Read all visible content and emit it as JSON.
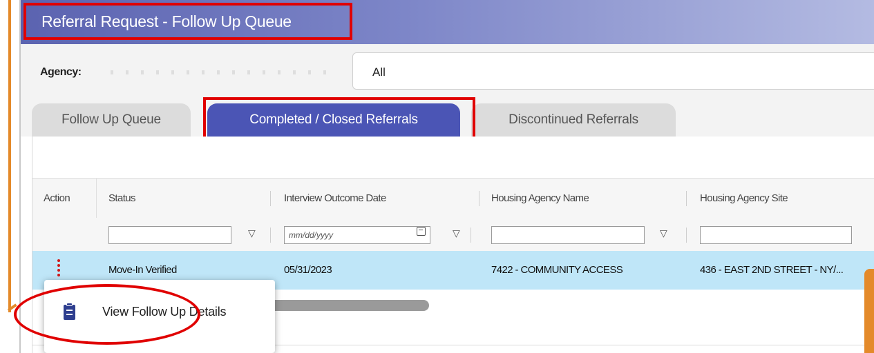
{
  "window": {
    "title": "Referral Request - Follow Up Queue"
  },
  "agency": {
    "label": "Agency:",
    "selected": "All"
  },
  "tabs": [
    {
      "label": "Follow Up Queue",
      "active": false
    },
    {
      "label": "Completed / Closed Referrals",
      "active": true
    },
    {
      "label": "Discontinued Referrals",
      "active": false
    }
  ],
  "table": {
    "columns": [
      "Action",
      "Status",
      "Interview Outcome Date",
      "Housing Agency Name",
      "Housing Agency Site"
    ],
    "date_placeholder": "mm/dd/yyyy",
    "rows": [
      {
        "status": "Move-In Verified",
        "interview_outcome_date": "05/31/2023",
        "housing_agency_name": "7422 - COMMUNITY ACCESS",
        "housing_agency_site": "436 - EAST 2ND STREET - NY/..."
      }
    ]
  },
  "context_menu": {
    "items": [
      {
        "label": "View Follow Up Details",
        "icon": "clipboard-icon"
      }
    ]
  },
  "colors": {
    "header_start": "#5b63b0",
    "active_tab": "#4b55b5",
    "selected_row": "#bfe6f8",
    "highlight": "#e00000",
    "callout": "#e48a2a",
    "action_dots": "#d01818"
  }
}
